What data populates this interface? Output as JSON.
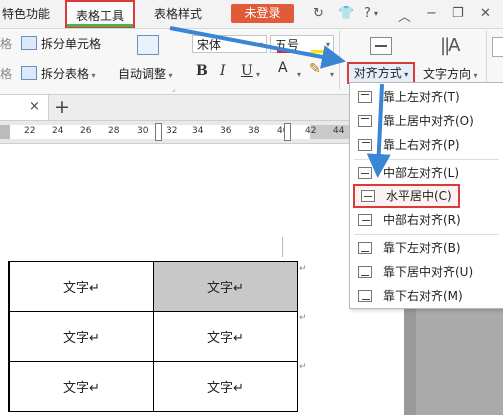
{
  "menubar": {
    "special_features": "特色功能",
    "table_tools": "表格工具",
    "table_style": "表格样式",
    "login": "未登录",
    "help_glyph": "?"
  },
  "ribbon": {
    "split_cells": "拆分单元格",
    "split_table": "拆分表格",
    "autofit": "自动调整",
    "font_name": "宋体",
    "font_size": "五号",
    "bold": "B",
    "italic": "I",
    "underline": "U",
    "font_color": "A",
    "align_button": "对齐方式",
    "text_direction": "文字方向",
    "left_cut_1": "格",
    "left_cut_2": "格"
  },
  "docbar": {
    "close": "×",
    "new_tab": "+"
  },
  "ruler": {
    "ticks": [
      "22",
      "24",
      "26",
      "28",
      "30",
      "32",
      "34",
      "36",
      "38",
      "40",
      "42",
      "44"
    ]
  },
  "alignment_menu": {
    "items": [
      {
        "label": "靠上左对齐(T)"
      },
      {
        "label": "靠上居中对齐(O)"
      },
      {
        "label": "靠上右对齐(P)"
      },
      {
        "label": "中部左对齐(L)"
      },
      {
        "label": "水平居中(C)"
      },
      {
        "label": "中部右对齐(R)"
      },
      {
        "label": "靠下左对齐(B)"
      },
      {
        "label": "靠下居中对齐(U)"
      },
      {
        "label": "靠下右对齐(M)"
      }
    ]
  },
  "table": {
    "rows": [
      [
        "文字↵",
        "文字↵"
      ],
      [
        "文字↵",
        "文字↵"
      ],
      [
        "文字↵",
        "文字↵"
      ]
    ],
    "end_mark": "↵"
  }
}
